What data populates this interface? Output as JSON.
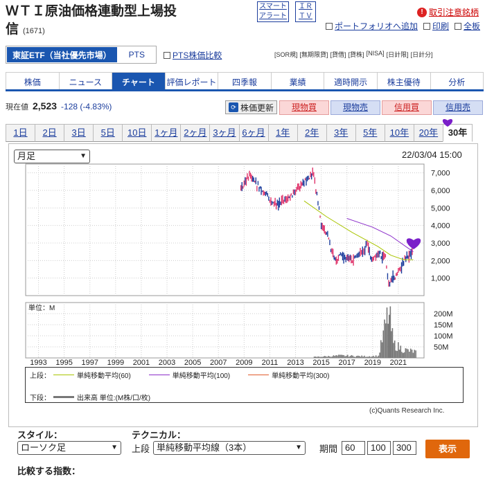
{
  "header": {
    "title": "ＷＴＩ原油価格連動型上場投信",
    "code": "(1671)",
    "smart_alert": [
      "スマート",
      "アラート"
    ],
    "ir_tv": [
      "ＩＲ",
      "ＴＶ"
    ],
    "margin_notice": "取引注意銘柄",
    "links": [
      "ポートフォリオへ追加",
      "印刷",
      "全板"
    ]
  },
  "market": {
    "active": "東証ETF（当社優先市場）",
    "pts": "PTS",
    "pts_compare": "PTS株価比較",
    "badges": [
      "[SOR規]",
      "[無期限貸]",
      "[貸借]",
      "[貸株]",
      "[NISA]",
      "[日計限]",
      "[日計分]"
    ]
  },
  "tabs": [
    "株価",
    "ニュース",
    "チャート",
    "評価レポート",
    "四季報",
    "業績",
    "適時開示",
    "株主優待",
    "分析"
  ],
  "active_tab": "チャート",
  "price": {
    "label": "現在値",
    "value": "2,523",
    "change": "-128 (-4.83%)",
    "refresh": "株価更新",
    "trade_buttons": [
      "現物買",
      "現物売",
      "信用買",
      "信用売"
    ]
  },
  "periods": [
    "1日",
    "2日",
    "3日",
    "5日",
    "10日",
    "1ヶ月",
    "2ヶ月",
    "3ヶ月",
    "6ヶ月",
    "1年",
    "2年",
    "3年",
    "5年",
    "10年",
    "20年",
    "30年"
  ],
  "active_period": "30年",
  "chart": {
    "interval": "月足",
    "date": "22/03/04 15:00",
    "volume_unit_label": "単位：M",
    "credit": "(c)Quants Research Inc.",
    "legend_upper_label": "上段：",
    "legend_lower_label": "下段：",
    "legend_items": [
      "単純移動平均(60)",
      "単純移動平均(100)",
      "単純移動平均(300)"
    ],
    "legend_volume": "出来高 単位:(M株/口/枚)",
    "colors": {
      "candle_up": "#e0336a",
      "candle_down": "#1a3c9c",
      "ma60": "#a9c400",
      "ma100": "#8a2cc9",
      "ma300": "#e05a2a",
      "volume": "#777777",
      "annotation": "#7a1fc9"
    }
  },
  "chart_data": {
    "type": "line",
    "title": "",
    "x_tick_labels": [
      "1993",
      "1995",
      "1997",
      "1999",
      "2001",
      "2003",
      "2005",
      "2007",
      "2009",
      "2011",
      "2013",
      "2015",
      "2017",
      "2019",
      "2021"
    ],
    "y_tick_labels": [
      "7,000",
      "6,000",
      "5,000",
      "4,000",
      "3,000",
      "2,000",
      "1,000"
    ],
    "ylim": [
      0,
      7500
    ],
    "volume_tick_labels": [
      "200M",
      "150M",
      "100M",
      "50M"
    ],
    "series": [
      {
        "name": "株価",
        "x": [
          "2008-10",
          "2009-06",
          "2010-06",
          "2011-04",
          "2012-06",
          "2013-06",
          "2014-06",
          "2015-01",
          "2015-06",
          "2016-02",
          "2016-10",
          "2017-06",
          "2018-09",
          "2018-12",
          "2019-06",
          "2020-01",
          "2020-04",
          "2020-10",
          "2021-06",
          "2022-03"
        ],
        "values": [
          6100,
          6800,
          6000,
          5200,
          5500,
          6300,
          6900,
          4000,
          3600,
          2000,
          2200,
          2000,
          2800,
          2000,
          2300,
          2200,
          700,
          1100,
          1900,
          2523
        ]
      },
      {
        "name": "単純移動平均(60)",
        "x": [
          "2013-09",
          "2015-06",
          "2017-06",
          "2019-06",
          "2020-06",
          "2021-06",
          "2022-03"
        ],
        "values": [
          5400,
          4500,
          3600,
          2800,
          2300,
          2050,
          2050
        ]
      },
      {
        "name": "単純移動平均(100)",
        "x": [
          "2017-01",
          "2019-01",
          "2020-06",
          "2022-03"
        ],
        "values": [
          4400,
          3900,
          3400,
          2500
        ]
      }
    ],
    "volume": {
      "x": [
        "2014",
        "2015",
        "2016",
        "2017",
        "2018",
        "2019",
        "2020-03",
        "2020-05",
        "2020-08",
        "2021",
        "2022"
      ],
      "values": [
        5,
        8,
        12,
        10,
        8,
        10,
        220,
        180,
        70,
        40,
        30
      ]
    }
  },
  "controls": {
    "style_label": "スタイル：",
    "style_value": "ローソク足",
    "technical_label": "テクニカル：",
    "upper_label": "上段",
    "technical_value": "単純移動平均線（3本）",
    "period_label": "期間",
    "periods": [
      "60",
      "100",
      "300"
    ],
    "submit": "表示",
    "compare_label": "比較する指数："
  }
}
